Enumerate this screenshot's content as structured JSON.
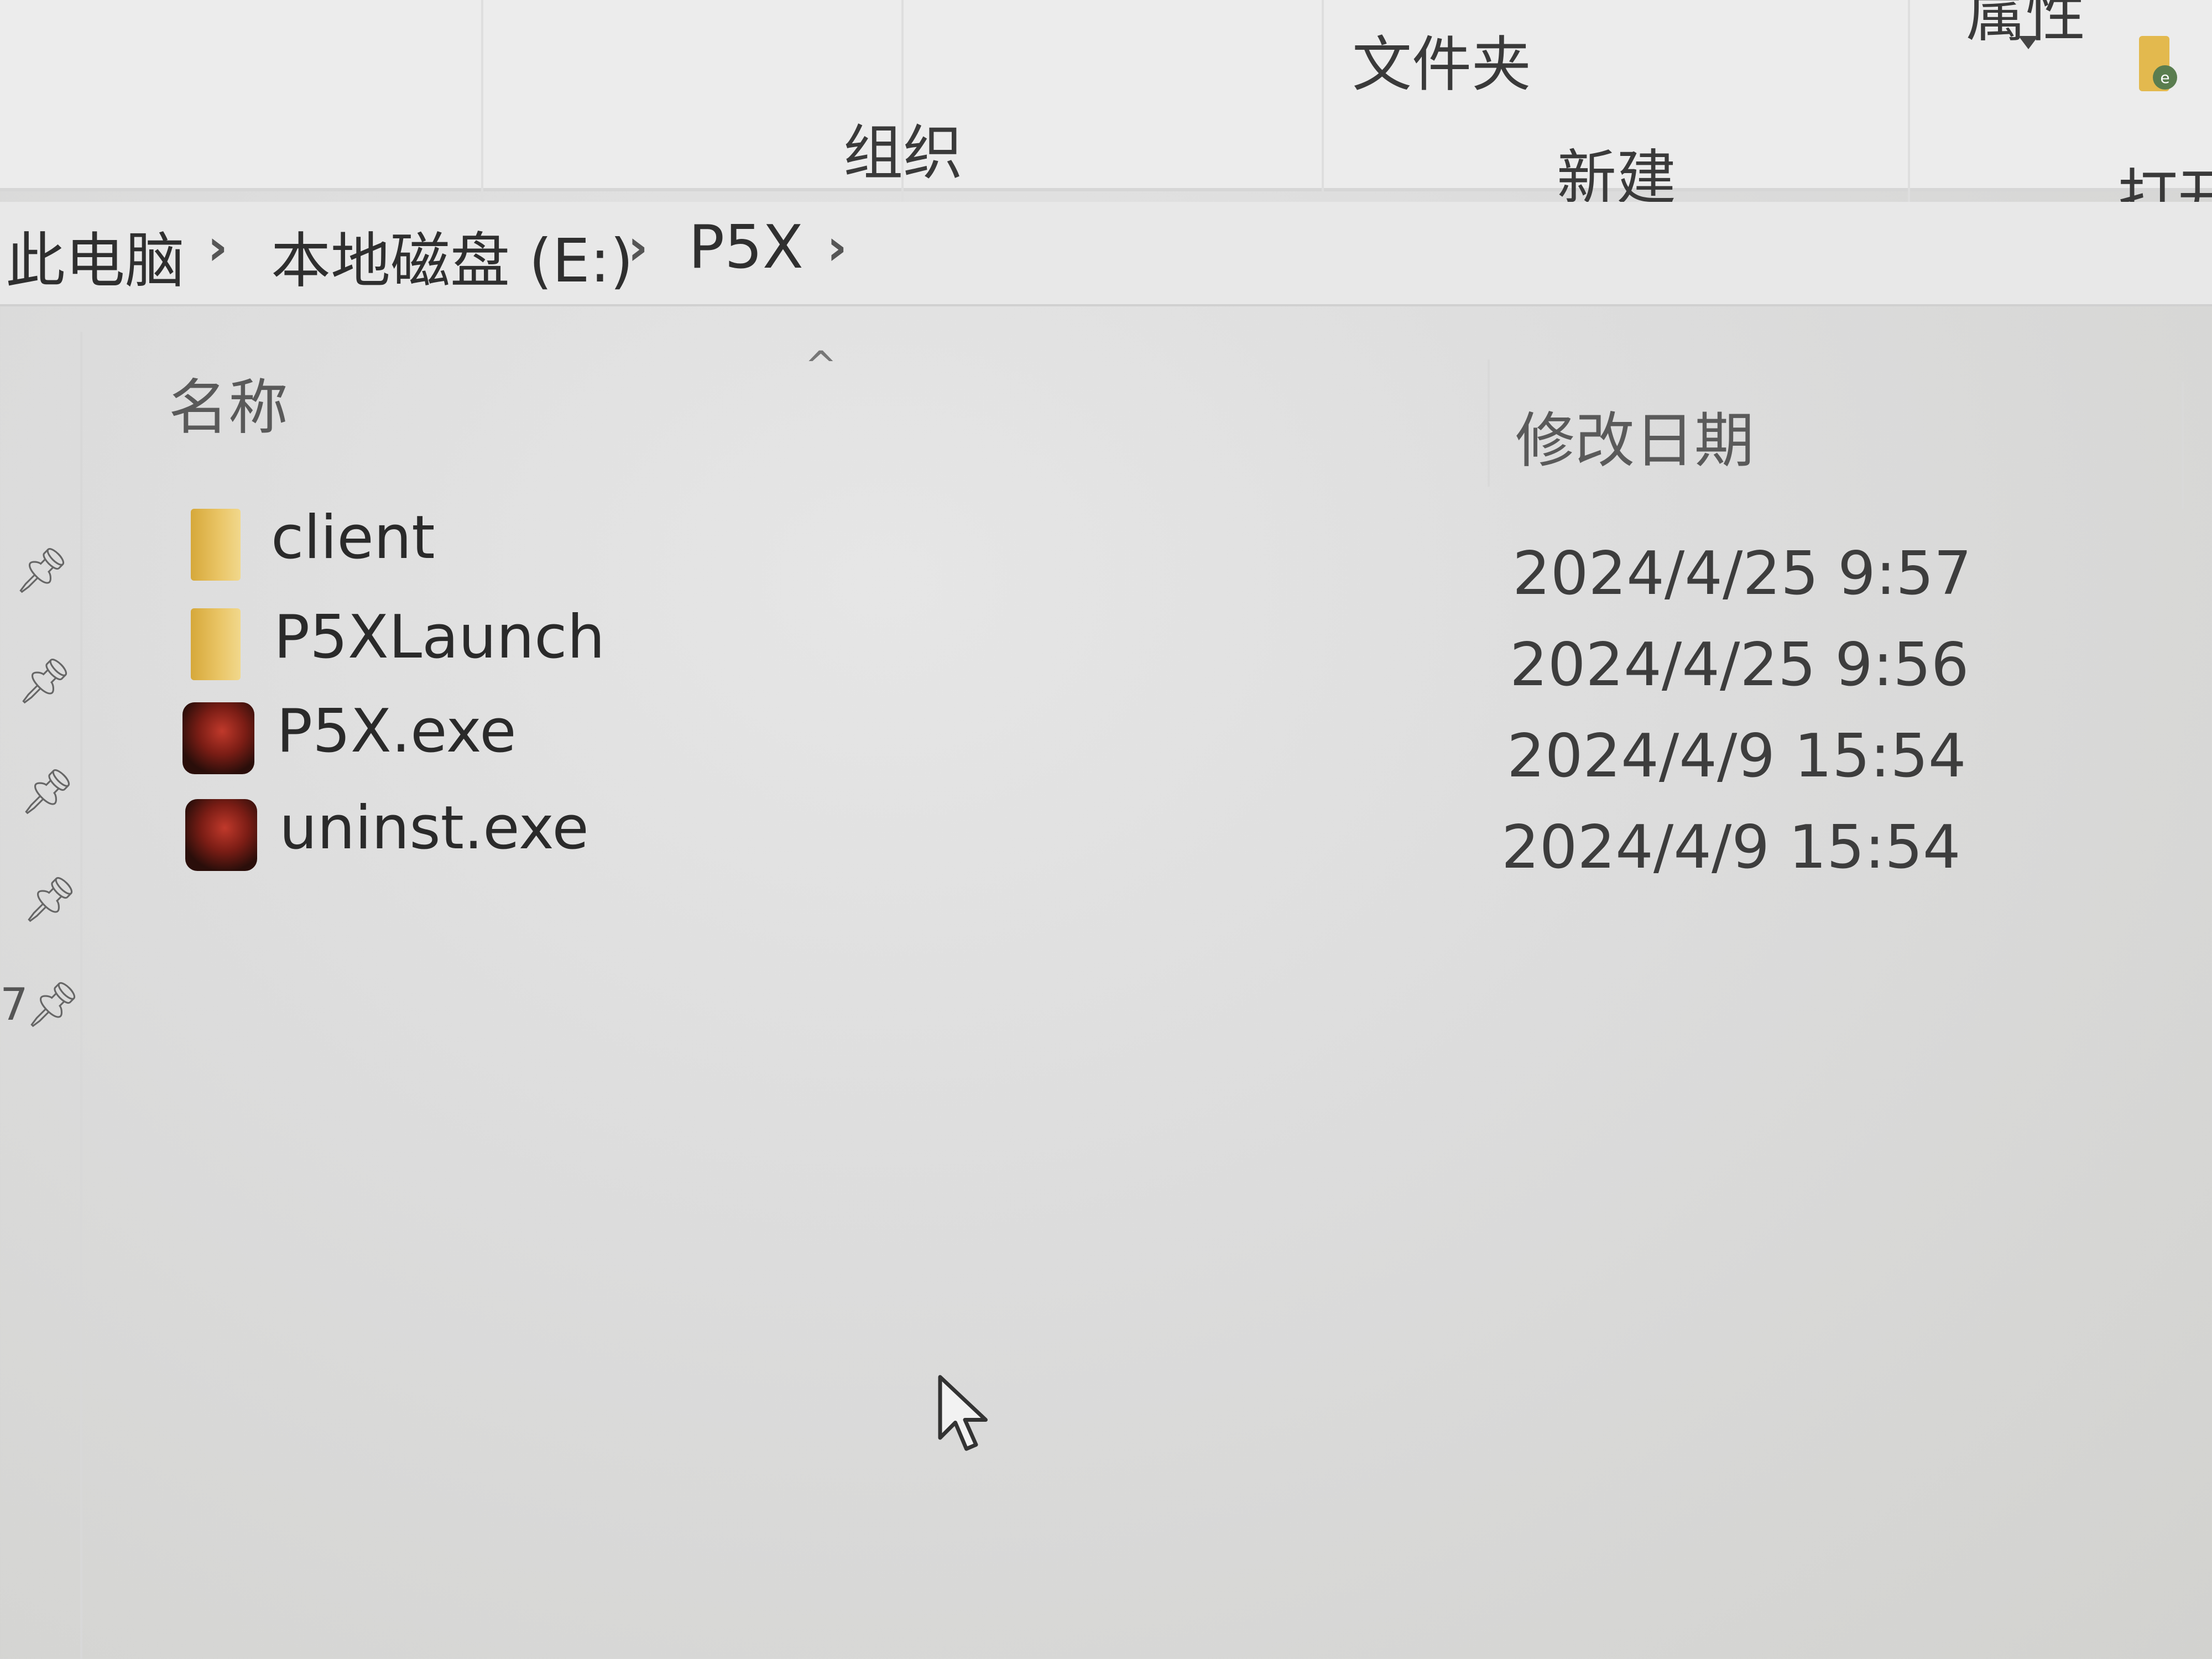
{
  "ribbon": {
    "organize_label": "组织",
    "new_label": "新建",
    "folder_label": "文件夹",
    "properties_label": "属性",
    "open_label": "打开"
  },
  "breadcrumb": [
    "此电脑",
    "本地磁盘 (E:)",
    "P5X"
  ],
  "columns": {
    "name": "名称",
    "modified": "修改日期"
  },
  "files": [
    {
      "name": "client",
      "modified": "2024/4/25 9:57",
      "type_icon": "folder-icon"
    },
    {
      "name": "P5XLaunch",
      "modified": "2024/4/25 9:56",
      "type_icon": "folder-icon"
    },
    {
      "name": "P5X.exe",
      "modified": "2024/4/9 15:54",
      "type_icon": "app-icon"
    },
    {
      "name": "uninst.exe",
      "modified": "2024/4/9 15:54",
      "type_icon": "app-icon"
    }
  ],
  "left_pins": [
    "pin-icon",
    "pin-icon",
    "pin-icon",
    "pin-icon",
    "pin-icon"
  ],
  "left_stray_text": "7",
  "colors": {
    "folder": "#e3b94e",
    "app_icon": "#8b2a1f",
    "background": "#dcdcdc"
  }
}
